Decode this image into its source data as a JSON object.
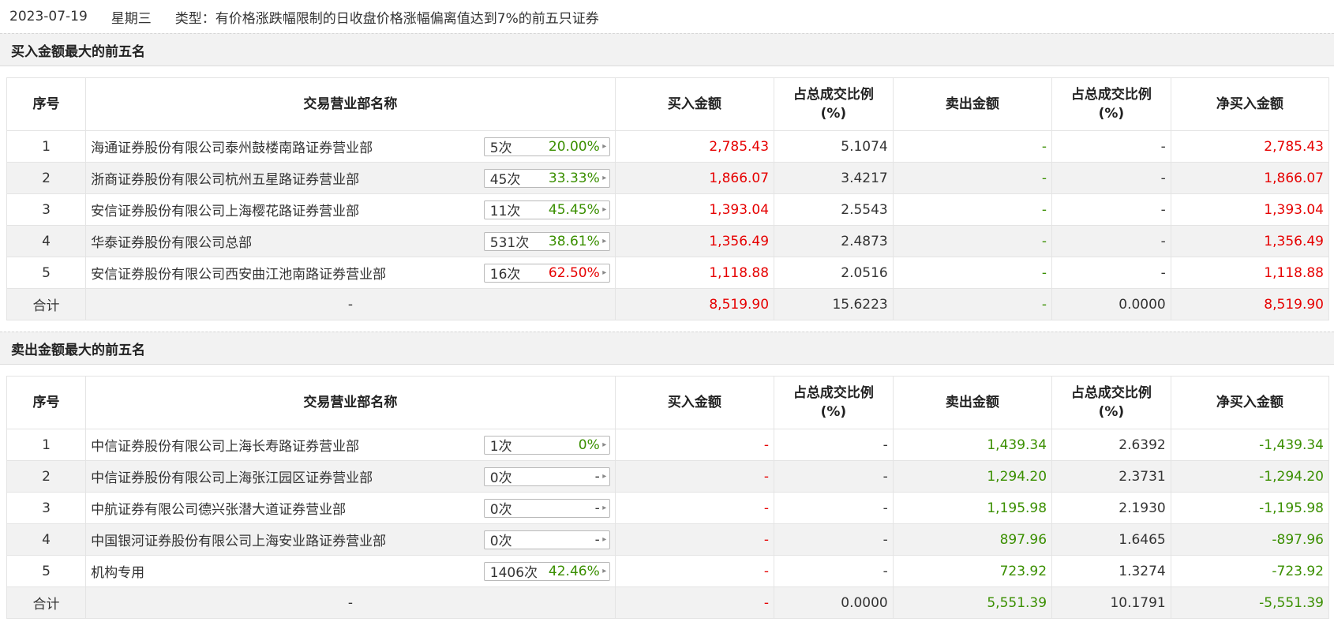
{
  "header": {
    "date": "2023-07-19",
    "weekday": "星期三",
    "type_text": "类型：有价格涨跌幅限制的日收盘价格涨幅偏离值达到7%的前五只证券"
  },
  "columns": {
    "seq": "序号",
    "name": "交易营业部名称",
    "buy": "买入金额",
    "ratio_line1": "占总成交比例",
    "ratio_line2": "(%)",
    "sell": "卖出金额",
    "net": "净买入金额"
  },
  "buy_section": {
    "title": "买入金额最大的前五名",
    "rows": [
      {
        "seq": "1",
        "name": "海通证券股份有限公司泰州鼓楼南路证券营业部",
        "count": "5次",
        "pct": "20.00%",
        "buy": "2,785.43",
        "buy_ratio": "5.1074",
        "sell": "-",
        "sell_ratio": "-",
        "net": "2,785.43"
      },
      {
        "seq": "2",
        "name": "浙商证券股份有限公司杭州五星路证券营业部",
        "count": "45次",
        "pct": "33.33%",
        "buy": "1,866.07",
        "buy_ratio": "3.4217",
        "sell": "-",
        "sell_ratio": "-",
        "net": "1,866.07"
      },
      {
        "seq": "3",
        "name": "安信证券股份有限公司上海樱花路证券营业部",
        "count": "11次",
        "pct": "45.45%",
        "buy": "1,393.04",
        "buy_ratio": "2.5543",
        "sell": "-",
        "sell_ratio": "-",
        "net": "1,393.04"
      },
      {
        "seq": "4",
        "name": "华泰证券股份有限公司总部",
        "count": "531次",
        "pct": "38.61%",
        "buy": "1,356.49",
        "buy_ratio": "2.4873",
        "sell": "-",
        "sell_ratio": "-",
        "net": "1,356.49"
      },
      {
        "seq": "5",
        "name": "安信证券股份有限公司西安曲江池南路证券营业部",
        "count": "16次",
        "pct": "62.50%",
        "buy": "1,118.88",
        "buy_ratio": "2.0516",
        "sell": "-",
        "sell_ratio": "-",
        "net": "1,118.88"
      }
    ],
    "total": {
      "label": "合计",
      "name": "-",
      "buy": "8,519.90",
      "buy_ratio": "15.6223",
      "sell": "-",
      "sell_ratio": "0.0000",
      "net": "8,519.90"
    }
  },
  "sell_section": {
    "title": "卖出金额最大的前五名",
    "rows": [
      {
        "seq": "1",
        "name": "中信证券股份有限公司上海长寿路证券营业部",
        "count": "1次",
        "pct": "0%",
        "buy": "-",
        "buy_ratio": "-",
        "sell": "1,439.34",
        "sell_ratio": "2.6392",
        "net": "-1,439.34"
      },
      {
        "seq": "2",
        "name": "中信证券股份有限公司上海张江园区证券营业部",
        "count": "0次",
        "pct": "-",
        "buy": "-",
        "buy_ratio": "-",
        "sell": "1,294.20",
        "sell_ratio": "2.3731",
        "net": "-1,294.20"
      },
      {
        "seq": "3",
        "name": "中航证券有限公司德兴张潜大道证券营业部",
        "count": "0次",
        "pct": "-",
        "buy": "-",
        "buy_ratio": "-",
        "sell": "1,195.98",
        "sell_ratio": "2.1930",
        "net": "-1,195.98"
      },
      {
        "seq": "4",
        "name": "中国银河证券股份有限公司上海安业路证券营业部",
        "count": "0次",
        "pct": "-",
        "buy": "-",
        "buy_ratio": "-",
        "sell": "897.96",
        "sell_ratio": "1.6465",
        "net": "-897.96"
      },
      {
        "seq": "5",
        "name": "机构专用",
        "count": "1406次",
        "pct": "42.46%",
        "buy": "-",
        "buy_ratio": "-",
        "sell": "723.92",
        "sell_ratio": "1.3274",
        "net": "-723.92"
      }
    ],
    "total": {
      "label": "合计",
      "name": "-",
      "buy": "-",
      "buy_ratio": "0.0000",
      "sell": "5,551.39",
      "sell_ratio": "10.1791",
      "net": "-5,551.39"
    }
  },
  "colors": {
    "up": "#e60000",
    "down": "#3a8f00",
    "text": "#333333",
    "stripe": "#f2f2f2"
  },
  "icons": {
    "badge_arrow": "caret-right-icon"
  }
}
